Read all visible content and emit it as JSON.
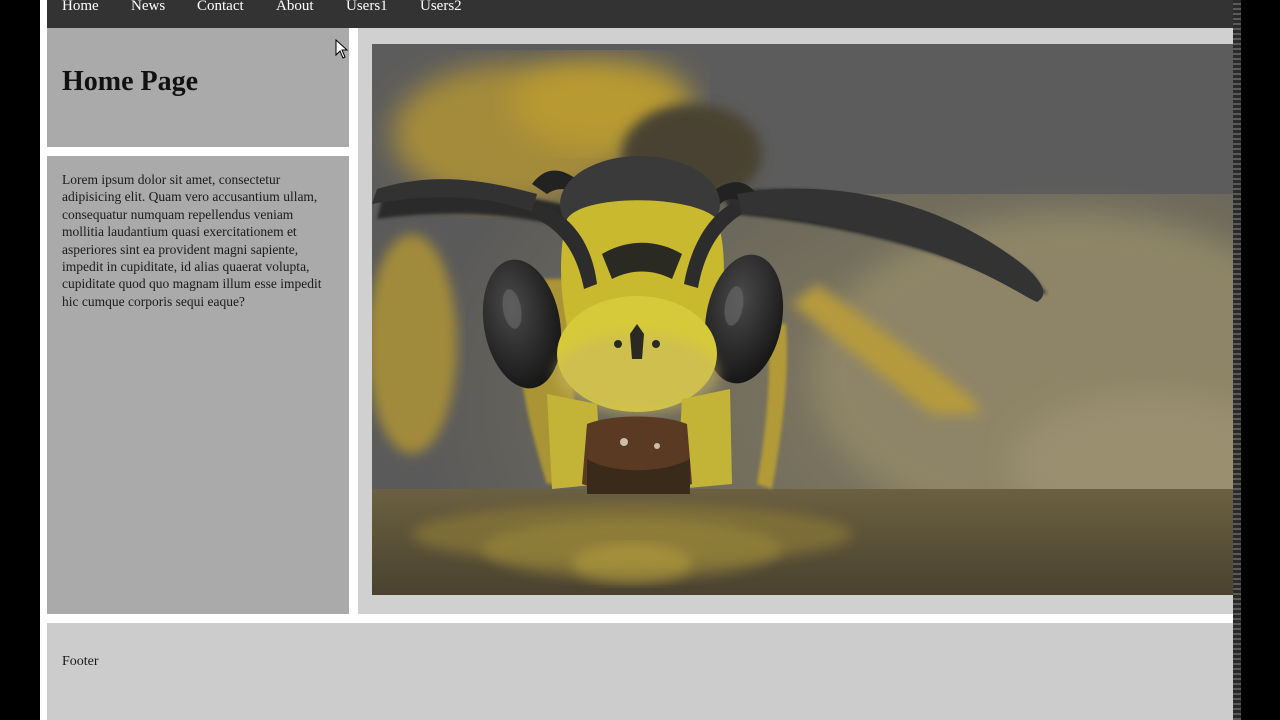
{
  "nav": {
    "items": [
      {
        "label": "Home"
      },
      {
        "label": "News"
      },
      {
        "label": "Contact"
      },
      {
        "label": "About"
      },
      {
        "label": "Users1"
      },
      {
        "label": "Users2"
      }
    ]
  },
  "header": {
    "title": "Home Page"
  },
  "sidebar": {
    "text": "Lorem ipsum dolor sit amet, consectetur adipisicing elit. Quam vero accusantium ullam, consequatur numquam repellendus veniam mollitia laudantium quasi exercitationem et asperiores sint ea provident magni sapiente, impedit in cupiditate, id alias quaerat volupta, cupiditate quod quo magnam illum esse impedit hic cumque corporis sequi eaque?"
  },
  "main": {
    "image_subject": "wasp-close-up-photo"
  },
  "footer": {
    "text": "Footer"
  },
  "colors": {
    "navbar_bg": "#333333",
    "panel_bg": "#aaaaaa",
    "main_bg": "#d0d0d0",
    "footer_bg": "#cccccc"
  }
}
